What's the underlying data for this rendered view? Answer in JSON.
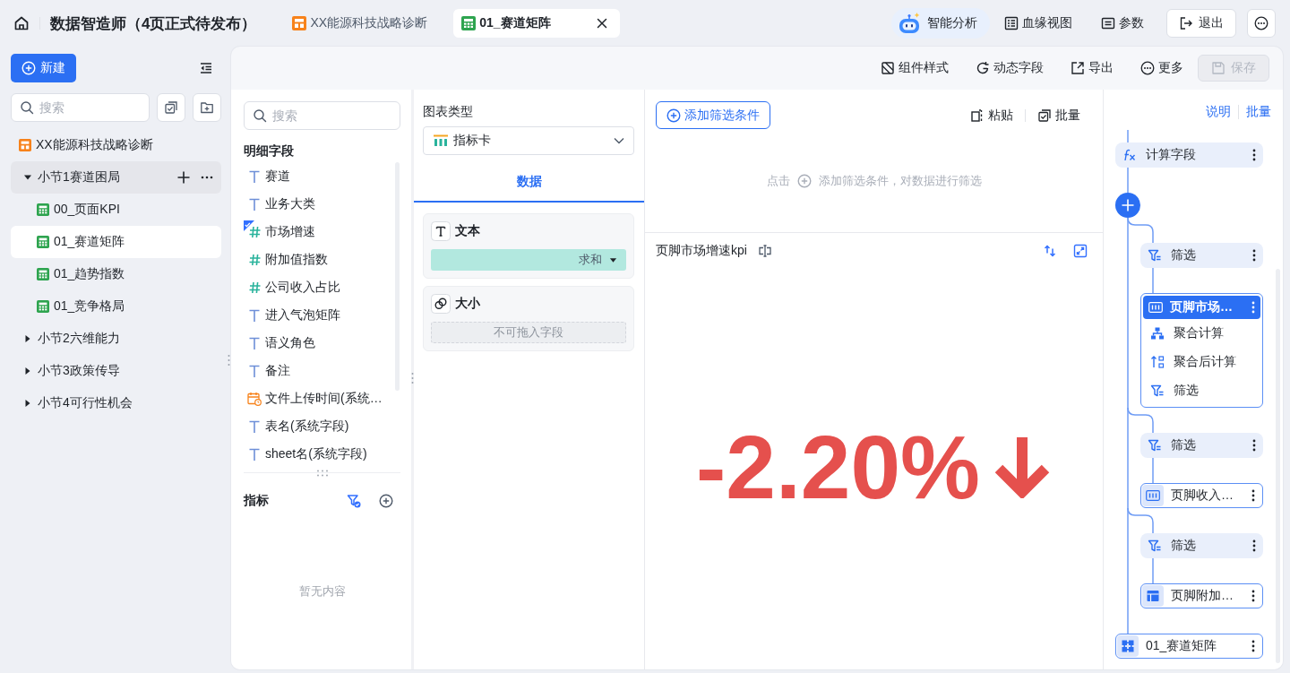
{
  "topbar": {
    "title": "数据智造师（4页正式待发布）",
    "tabs": [
      {
        "label": "XX能源科技战略诊断",
        "kind": "dashboard",
        "selected": false
      },
      {
        "label": "01_赛道矩阵",
        "kind": "sheet",
        "selected": true
      }
    ],
    "actions": [
      {
        "label": "智能分析",
        "kind": "ai"
      },
      {
        "label": "血缘视图",
        "kind": "lineage"
      },
      {
        "label": "参数",
        "kind": "params"
      },
      {
        "label": "退出",
        "kind": "exit"
      }
    ]
  },
  "sidebar": {
    "new_button": "新建",
    "search": {
      "placeholder": "搜索"
    },
    "tree": [
      {
        "label": "XX能源科技战略诊断",
        "kind": "dashboard",
        "selected": false,
        "hovered": false
      },
      {
        "label": "小节1赛道困局",
        "kind": "section",
        "selected": false,
        "hovered": true,
        "expanded": true,
        "children": [
          {
            "label": "00_页面KPI",
            "kind": "sheet",
            "selected": false
          },
          {
            "label": "01_赛道矩阵",
            "kind": "sheet",
            "selected": true
          },
          {
            "label": "01_趋势指数",
            "kind": "sheet",
            "selected": false
          },
          {
            "label": "01_竞争格局",
            "kind": "sheet",
            "selected": false
          }
        ]
      },
      {
        "label": "小节2六维能力",
        "kind": "section",
        "selected": false,
        "hovered": false,
        "expanded": false
      },
      {
        "label": "小节3政策传导",
        "kind": "section",
        "selected": false,
        "hovered": false,
        "expanded": false
      },
      {
        "label": "小节4可行性机会",
        "kind": "section",
        "selected": false,
        "hovered": false,
        "expanded": false
      }
    ]
  },
  "toolbar": [
    {
      "label": "组件样式",
      "kind": "style",
      "disabled": false
    },
    {
      "label": "动态字段",
      "kind": "dynamic",
      "disabled": false
    },
    {
      "label": "导出",
      "kind": "export",
      "disabled": false
    },
    {
      "label": "更多",
      "kind": "more",
      "disabled": false
    },
    {
      "label": "保存",
      "kind": "save",
      "disabled": true
    }
  ],
  "fields": {
    "search": {
      "placeholder": "搜索"
    },
    "title": "明细字段",
    "items": [
      {
        "label": "赛道",
        "kind": "text",
        "used": false
      },
      {
        "label": "业务大类",
        "kind": "text",
        "used": false
      },
      {
        "label": "市场增速",
        "kind": "number",
        "used": true
      },
      {
        "label": "附加值指数",
        "kind": "number",
        "used": false
      },
      {
        "label": "公司收入占比",
        "kind": "number",
        "used": false
      },
      {
        "label": "进入气泡矩阵",
        "kind": "text",
        "used": false
      },
      {
        "label": "语义角色",
        "kind": "text",
        "used": false
      },
      {
        "label": "备注",
        "kind": "text",
        "used": false
      },
      {
        "label": "文件上传时间(系统…",
        "kind": "date",
        "used": false
      },
      {
        "label": "表名(系统字段)",
        "kind": "text",
        "used": false
      },
      {
        "label": "sheet名(系统字段)",
        "kind": "text",
        "used": false
      }
    ],
    "metrics": {
      "title": "指标",
      "empty": "暂无内容"
    }
  },
  "chart_config": {
    "type_label": "图表类型",
    "chart_type": "指标卡",
    "tabs": [
      {
        "label": "数据",
        "selected": true
      }
    ],
    "slots": [
      {
        "label": "文本",
        "kind": "text",
        "field": {
          "aggregation": "求和"
        }
      },
      {
        "label": "大小",
        "kind": "size",
        "placeholder": "不可拖入字段"
      }
    ]
  },
  "canvas": {
    "add_filter": "添加筛选条件",
    "actions": [
      {
        "label": "粘贴",
        "kind": "paste"
      },
      {
        "label": "批量",
        "kind": "batch"
      }
    ],
    "hint": {
      "before": "点击",
      "after": "添加筛选条件，对数据进行筛选"
    },
    "chart": {
      "title": "页脚市场增速kpi",
      "value": "-2.20%",
      "falling": true
    }
  },
  "flow": {
    "links": [
      {
        "label": "说明"
      },
      {
        "label": "批量"
      }
    ],
    "nodes": [
      {
        "kind": "calc",
        "label": "计算字段",
        "selected": false
      },
      {
        "kind": "add",
        "selected": false
      },
      {
        "kind": "filter",
        "label": "筛选",
        "selected": false
      },
      {
        "kind": "group",
        "label": "页脚市场…",
        "selected": true,
        "steps": [
          {
            "kind": "aggregate",
            "label": "聚合计算"
          },
          {
            "kind": "post_aggregate",
            "label": "聚合后计算"
          },
          {
            "kind": "filter",
            "label": "筛选"
          }
        ]
      },
      {
        "kind": "filter",
        "label": "筛选",
        "selected": false
      },
      {
        "kind": "metric",
        "label": "页脚收入…",
        "selected": false
      },
      {
        "kind": "filter",
        "label": "筛选",
        "selected": false
      },
      {
        "kind": "table",
        "label": "页脚附加…",
        "selected": false
      },
      {
        "kind": "source",
        "label": "01_赛道矩阵",
        "selected": false
      }
    ]
  }
}
